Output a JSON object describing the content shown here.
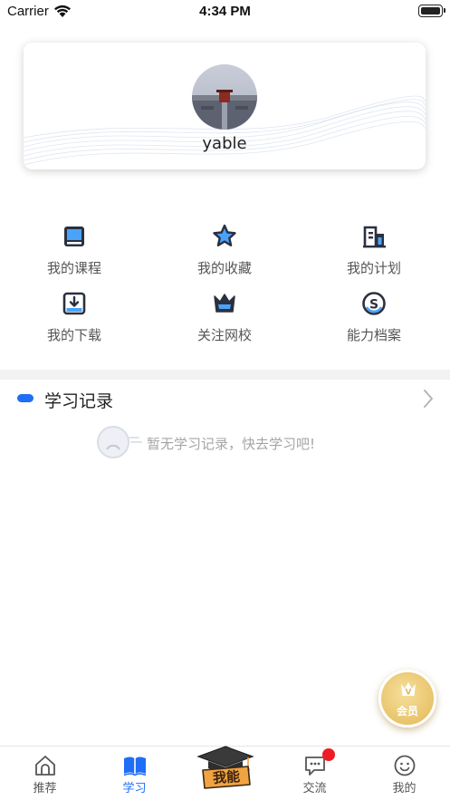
{
  "status_bar": {
    "carrier": "Carrier",
    "time": "4:34 PM"
  },
  "profile": {
    "username": "yable"
  },
  "grid": [
    {
      "label": "我的课程",
      "icon": "book-icon"
    },
    {
      "label": "我的收藏",
      "icon": "star-icon"
    },
    {
      "label": "我的计划",
      "icon": "plan-icon"
    },
    {
      "label": "我的下载",
      "icon": "download-icon"
    },
    {
      "label": "关注网校",
      "icon": "crown-icon"
    },
    {
      "label": "能力档案",
      "icon": "coin-icon"
    }
  ],
  "history": {
    "title": "学习记录",
    "empty_text": "暂无学习记录，快去学习吧!"
  },
  "vip": {
    "label": "会员"
  },
  "tabs": [
    {
      "label": "推荐",
      "icon": "home-icon",
      "active": false
    },
    {
      "label": "学习",
      "icon": "open-book-icon",
      "active": true
    },
    {
      "label": "我能",
      "icon": "graduation-cap-icon",
      "active": false
    },
    {
      "label": "交流",
      "icon": "chat-icon",
      "active": false
    },
    {
      "label": "我的",
      "icon": "smiley-icon",
      "active": false
    }
  ],
  "colors": {
    "accent": "#1f6ef5",
    "badge": "#ee1c25",
    "vip_gold": "#e8c46b"
  }
}
